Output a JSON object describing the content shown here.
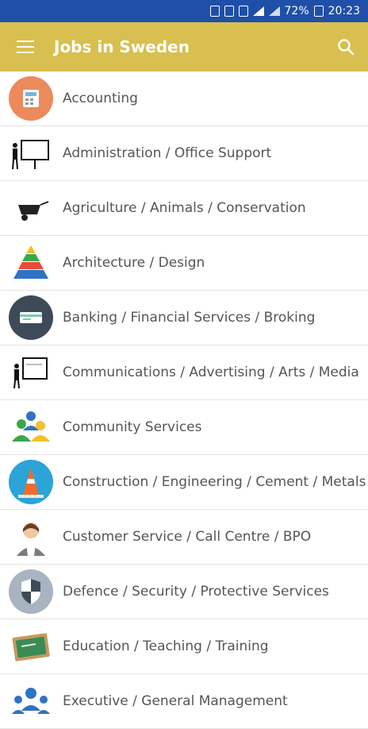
{
  "status": {
    "battery": "72%",
    "time": "20:23"
  },
  "appbar": {
    "title": "Jobs in Sweden"
  },
  "categories": [
    {
      "label": "Accounting",
      "icon": "calculator-icon"
    },
    {
      "label": "Administration / Office Support",
      "icon": "presentation-board-icon"
    },
    {
      "label": "Agriculture / Animals / Conservation",
      "icon": "wheelbarrow-icon"
    },
    {
      "label": "Architecture / Design",
      "icon": "pyramid-icon"
    },
    {
      "label": "Banking / Financial Services / Broking",
      "icon": "credit-card-icon"
    },
    {
      "label": "Communications / Advertising / Arts / Media",
      "icon": "presenter-icon"
    },
    {
      "label": "Community Services",
      "icon": "people-group-icon"
    },
    {
      "label": "Construction / Engineering / Cement / Metals",
      "icon": "traffic-cone-icon"
    },
    {
      "label": "Customer Service / Call Centre / BPO",
      "icon": "call-agent-icon"
    },
    {
      "label": "Defence / Security / Protective Services",
      "icon": "shield-icon"
    },
    {
      "label": "Education / Teaching / Training",
      "icon": "chalkboard-icon"
    },
    {
      "label": "Executive / General Management",
      "icon": "executives-icon"
    }
  ]
}
